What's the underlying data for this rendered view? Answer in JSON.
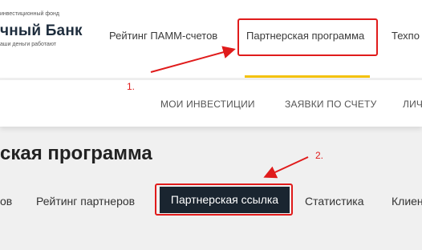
{
  "colors": {
    "annotation_red": "#e01b1b",
    "active_tab_bg": "#1a2530",
    "active_underline": "#f4c20d",
    "page_bg": "#f0f0f0"
  },
  "logo": {
    "tagline_top": "инвестиционный фонд",
    "name": "чный Банк",
    "tagline_bottom": "аши деньги работают"
  },
  "top_nav": {
    "items": [
      {
        "label": "Рейтинг ПАММ-счетов"
      },
      {
        "label": "Партнерская программа"
      },
      {
        "label": "Техпо"
      }
    ]
  },
  "sub_nav": {
    "items": [
      {
        "label": "МОИ ИНВЕСТИЦИИ"
      },
      {
        "label": "ЗАЯВКИ ПО СЧЕТУ"
      },
      {
        "label": "ЛИЧ"
      }
    ]
  },
  "page": {
    "title": "ская программа"
  },
  "tabs": {
    "items": [
      {
        "label": "ов"
      },
      {
        "label": "Рейтинг партнеров"
      },
      {
        "label": "Партнерская ссылка"
      },
      {
        "label": "Статистика"
      },
      {
        "label": "Клиен"
      }
    ]
  },
  "annotations": {
    "step1": "1.",
    "step2": "2."
  }
}
